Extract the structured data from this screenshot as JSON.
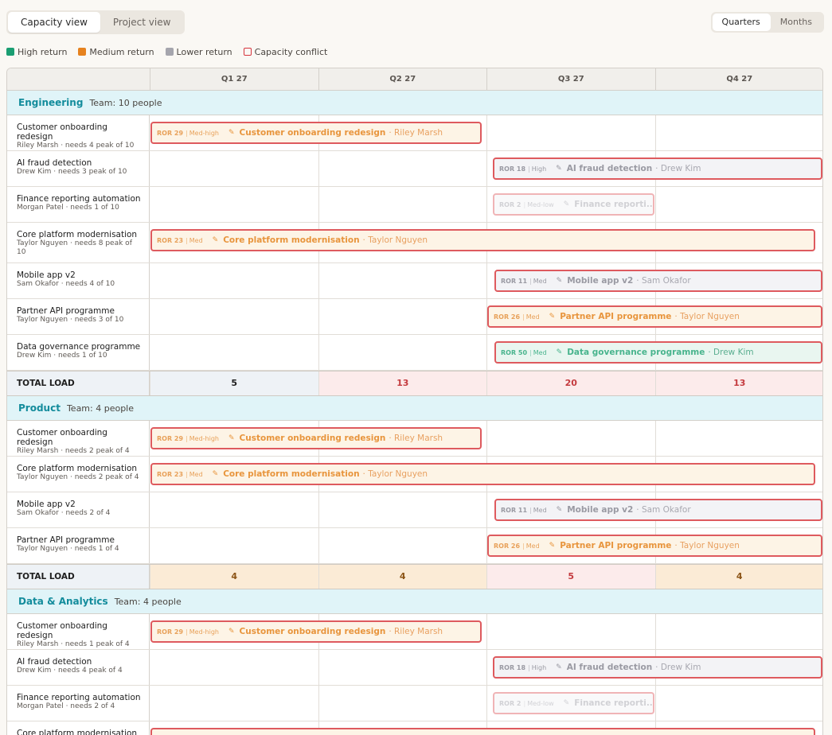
{
  "toolbar": {
    "views": [
      "Capacity view",
      "Project view"
    ],
    "scales": [
      "Quarters",
      "Months"
    ]
  },
  "legend": [
    {
      "label": "High return",
      "kind": "high"
    },
    {
      "label": "Medium return",
      "kind": "med"
    },
    {
      "label": "Lower return",
      "kind": "low"
    },
    {
      "label": "Capacity conflict",
      "kind": "conf"
    }
  ],
  "columns": [
    "Q1 27",
    "Q2 27",
    "Q3 27",
    "Q4 27"
  ],
  "colors": {
    "high": "#1a9e72",
    "medium": "#e6821e",
    "lower": "#a5a5ad",
    "conflict": "#d6353d",
    "team": "#138c9c"
  },
  "teams": [
    {
      "name": "Engineering",
      "size": "Team: 10 people",
      "rows": [
        {
          "project": "Customer onboarding redesign",
          "sub": "Riley Marsh · needs 4 peak of 10",
          "ror": "ROR 29",
          "level": "Med-high",
          "title": "Customer onboarding redesign",
          "owner": "· Riley Marsh",
          "kind": "med",
          "start": 0,
          "span": 2,
          "offset": "start",
          "fade": false
        },
        {
          "project": "AI fraud detection",
          "sub": "Drew Kim · needs 3 peak of 10",
          "ror": "ROR 18",
          "level": "High",
          "title": "AI fraud detection",
          "owner": "· Drew Kim",
          "kind": "low",
          "start": 2,
          "span": 2,
          "offset": "mid",
          "fade": false
        },
        {
          "project": "Finance reporting automation",
          "sub": "Morgan Patel · needs 1 of 10",
          "ror": "ROR 2",
          "level": "Med-low",
          "title": "Finance reporti...",
          "owner": "",
          "kind": "low",
          "start": 2,
          "span": 1,
          "offset": "mid",
          "fade": true
        },
        {
          "project": "Core platform modernisation",
          "sub": "Taylor Nguyen · needs 8 peak of 10",
          "ror": "ROR 23",
          "level": "Med",
          "title": "Core platform modernisation",
          "owner": "· Taylor Nguyen",
          "kind": "med",
          "start": 0,
          "span": 4,
          "offset": "start",
          "fade": false,
          "tall": true
        },
        {
          "project": "Mobile app v2",
          "sub": "Sam Okafor · needs 4 of 10",
          "ror": "ROR 11",
          "level": "Med",
          "title": "Mobile app v2",
          "owner": "· Sam Okafor",
          "kind": "low",
          "start": 2,
          "span": 2,
          "offset": "mid2",
          "fade": false
        },
        {
          "project": "Partner API programme",
          "sub": "Taylor Nguyen · needs 3 of 10",
          "ror": "ROR 26",
          "level": "Med",
          "title": "Partner API programme",
          "owner": "· Taylor Nguyen",
          "kind": "med",
          "start": 2,
          "span": 2,
          "offset": "start",
          "fade": false
        },
        {
          "project": "Data governance programme",
          "sub": "Drew Kim · needs 1 of 10",
          "ror": "ROR 50",
          "level": "Med",
          "title": "Data governance programme",
          "owner": "· Drew Kim",
          "kind": "high",
          "start": 2,
          "span": 2,
          "offset": "mid2",
          "fade": false
        }
      ],
      "total_label": "TOTAL LOAD",
      "totals": [
        {
          "value": "5",
          "state": "ok"
        },
        {
          "value": "13",
          "state": "over"
        },
        {
          "value": "20",
          "state": "over"
        },
        {
          "value": "13",
          "state": "over"
        }
      ]
    },
    {
      "name": "Product",
      "size": "Team: 4 people",
      "rows": [
        {
          "project": "Customer onboarding redesign",
          "sub": "Riley Marsh · needs 2 peak of 4",
          "ror": "ROR 29",
          "level": "Med-high",
          "title": "Customer onboarding redesign",
          "owner": "· Riley Marsh",
          "kind": "med",
          "start": 0,
          "span": 2,
          "offset": "start",
          "fade": false
        },
        {
          "project": "Core platform modernisation",
          "sub": "Taylor Nguyen · needs 2 peak of 4",
          "ror": "ROR 23",
          "level": "Med",
          "title": "Core platform modernisation",
          "owner": "· Taylor Nguyen",
          "kind": "med",
          "start": 0,
          "span": 4,
          "offset": "start",
          "fade": false,
          "short": true
        },
        {
          "project": "Mobile app v2",
          "sub": "Sam Okafor · needs 2 of 4",
          "ror": "ROR 11",
          "level": "Med",
          "title": "Mobile app v2",
          "owner": "· Sam Okafor",
          "kind": "low",
          "start": 2,
          "span": 2,
          "offset": "mid2",
          "fade": false
        },
        {
          "project": "Partner API programme",
          "sub": "Taylor Nguyen · needs 1 of 4",
          "ror": "ROR 26",
          "level": "Med",
          "title": "Partner API programme",
          "owner": "· Taylor Nguyen",
          "kind": "med",
          "start": 2,
          "span": 2,
          "offset": "start",
          "fade": false
        }
      ],
      "total_label": "TOTAL LOAD",
      "totals": [
        {
          "value": "4",
          "state": "warn"
        },
        {
          "value": "4",
          "state": "warn"
        },
        {
          "value": "5",
          "state": "over"
        },
        {
          "value": "4",
          "state": "warn"
        }
      ]
    },
    {
      "name": "Data & Analytics",
      "size": "Team: 4 people",
      "rows": [
        {
          "project": "Customer onboarding redesign",
          "sub": "Riley Marsh · needs 1 peak of 4",
          "ror": "ROR 29",
          "level": "Med-high",
          "title": "Customer onboarding redesign",
          "owner": "· Riley Marsh",
          "kind": "med",
          "start": 0,
          "span": 2,
          "offset": "start",
          "fade": false
        },
        {
          "project": "AI fraud detection",
          "sub": "Drew Kim · needs 4 peak of 4",
          "ror": "ROR 18",
          "level": "High",
          "title": "AI fraud detection",
          "owner": "· Drew Kim",
          "kind": "low",
          "start": 2,
          "span": 2,
          "offset": "mid",
          "fade": false
        },
        {
          "project": "Finance reporting automation",
          "sub": "Morgan Patel · needs 2 of 4",
          "ror": "ROR 2",
          "level": "Med-low",
          "title": "Finance reporti...",
          "owner": "",
          "kind": "low",
          "start": 2,
          "span": 1,
          "offset": "mid",
          "fade": true
        },
        {
          "project": "Core platform modernisation",
          "sub": "",
          "ror": "",
          "level": "",
          "title": "",
          "owner": "",
          "kind": "med",
          "start": 0,
          "span": 4,
          "offset": "start",
          "fade": false,
          "short": true
        }
      ]
    }
  ]
}
